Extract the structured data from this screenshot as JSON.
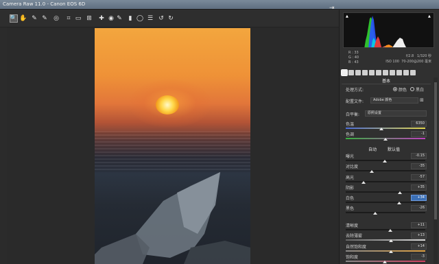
{
  "window": {
    "title": "Camera Raw 11.0 -  Canon EOS 6D"
  },
  "toolbar": {
    "tools": [
      {
        "icon": "zoom-icon",
        "glyph": "🔍"
      },
      {
        "icon": "hand-icon",
        "glyph": "✋"
      },
      {
        "icon": "white-balance-icon",
        "glyph": "✎"
      },
      {
        "icon": "color-sampler-icon",
        "glyph": "✎"
      },
      {
        "icon": "targeted-adjust-icon",
        "glyph": "◎"
      },
      {
        "icon": "crop-icon",
        "glyph": "⌗"
      },
      {
        "icon": "straighten-icon",
        "glyph": "▭"
      },
      {
        "icon": "transform-icon",
        "glyph": "⊞"
      },
      {
        "icon": "spot-removal-icon",
        "glyph": "✚"
      },
      {
        "icon": "red-eye-icon",
        "glyph": "◉"
      },
      {
        "icon": "adjustment-brush-icon",
        "glyph": "✎"
      },
      {
        "icon": "graduated-filter-icon",
        "glyph": "▮"
      },
      {
        "icon": "radial-filter-icon",
        "glyph": "◯"
      },
      {
        "icon": "preferences-icon",
        "glyph": "☰"
      },
      {
        "icon": "rotate-left-icon",
        "glyph": "↺"
      },
      {
        "icon": "rotate-right-icon",
        "glyph": "↻"
      }
    ],
    "export_icon": "⇥"
  },
  "histogram": {
    "r": "R :",
    "g": "G :",
    "b": "B :",
    "r_val": "33",
    "g_val": "40",
    "b_val": "43",
    "aperture": "f/2.8",
    "shutter": "1/320 秒",
    "iso": "ISO 100",
    "lens": "70-200@200 毫米"
  },
  "panel": {
    "title": "基本",
    "treatment_label": "处理方式:",
    "treatment_color": "颜色",
    "treatment_bw": "黑白",
    "profile_label": "配置文件:",
    "profile_value": "Adobe 颜色",
    "wb_label": "白平衡:",
    "wb_value": "原照设置",
    "auto_label": "自动",
    "default_label": "默认值",
    "colors": {
      "accent": "#3b6fb5"
    },
    "sliders": [
      {
        "name": "temp",
        "label": "色温",
        "value": "6350",
        "pos": 0.45
      },
      {
        "name": "tint",
        "label": "色调",
        "value": "-1",
        "pos": 0.5
      },
      {
        "name": "exposure",
        "label": "曝光",
        "value": "-0.15",
        "pos": 0.49
      },
      {
        "name": "contrast",
        "label": "对比度",
        "value": "-35",
        "pos": 0.33
      },
      {
        "name": "highlights",
        "label": "高光",
        "value": "-57",
        "pos": 0.22
      },
      {
        "name": "shadows",
        "label": "阴影",
        "value": "+35",
        "pos": 0.68
      },
      {
        "name": "whites",
        "label": "白色",
        "value": "+34",
        "pos": 0.67
      },
      {
        "name": "blacks",
        "label": "黑色",
        "value": "-26",
        "pos": 0.37
      },
      {
        "name": "texture",
        "label": "清晰度",
        "value": "+11",
        "pos": 0.56
      },
      {
        "name": "dehaze",
        "label": "去除薄雾",
        "value": "+13",
        "pos": 0.57
      },
      {
        "name": "vibrance",
        "label": "自然饱和度",
        "value": "+14",
        "pos": 0.57
      },
      {
        "name": "saturation",
        "label": "饱和度",
        "value": "-3",
        "pos": 0.49
      }
    ]
  }
}
